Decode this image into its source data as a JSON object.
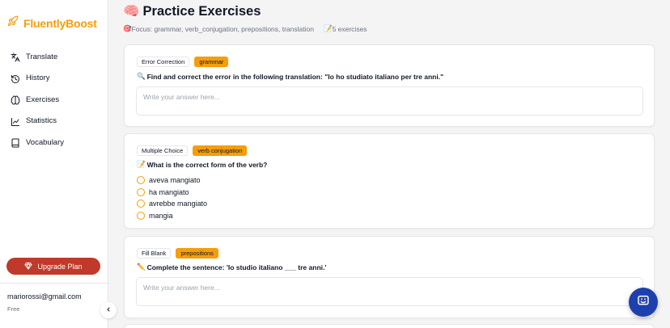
{
  "brand": {
    "name": "FluentlyBoost",
    "icon": "rocket-icon",
    "color": "#f59e0b"
  },
  "sidebar": {
    "items": [
      {
        "label": "Translate",
        "icon": "translate-icon"
      },
      {
        "label": "History",
        "icon": "history-icon"
      },
      {
        "label": "Exercises",
        "icon": "brain-icon"
      },
      {
        "label": "Statistics",
        "icon": "chart-line-icon"
      },
      {
        "label": "Vocabulary",
        "icon": "book-icon"
      }
    ],
    "upgrade_label": "Upgrade Plan",
    "email": "mariorossi@gmail.com",
    "plan": "Free"
  },
  "page": {
    "title_emoji": "🧠",
    "title": "Practice Exercises",
    "focus_emoji": "🎯",
    "focus": "Focus: grammar, verb_conjugation, prepositions, translation",
    "count_emoji": "📝",
    "count": "5 exercises"
  },
  "exercises": [
    {
      "type": "Error Correction",
      "category": "grammar",
      "icon": "🔍",
      "question": "Find and correct the error in the following translation: \"Io ho studiato italiano per tre anni.\"",
      "placeholder": "Write your answer here..."
    },
    {
      "type": "Multiple Choice",
      "category": "verb conjugation",
      "icon": "📝",
      "question": "What is the correct form of the verb?",
      "options": [
        "aveva mangiato",
        "ha mangiato",
        "avrebbe mangiato",
        "mangia"
      ]
    },
    {
      "type": "Fill Blank",
      "category": "prepositions",
      "icon": "✏️",
      "question": "Complete the sentence: 'Io studio italiano ___ tre anni.'",
      "placeholder": "Write your answer here..."
    }
  ],
  "colors": {
    "accent": "#f59e0b",
    "upgrade": "#c0392b",
    "chat": "#1e40af"
  }
}
